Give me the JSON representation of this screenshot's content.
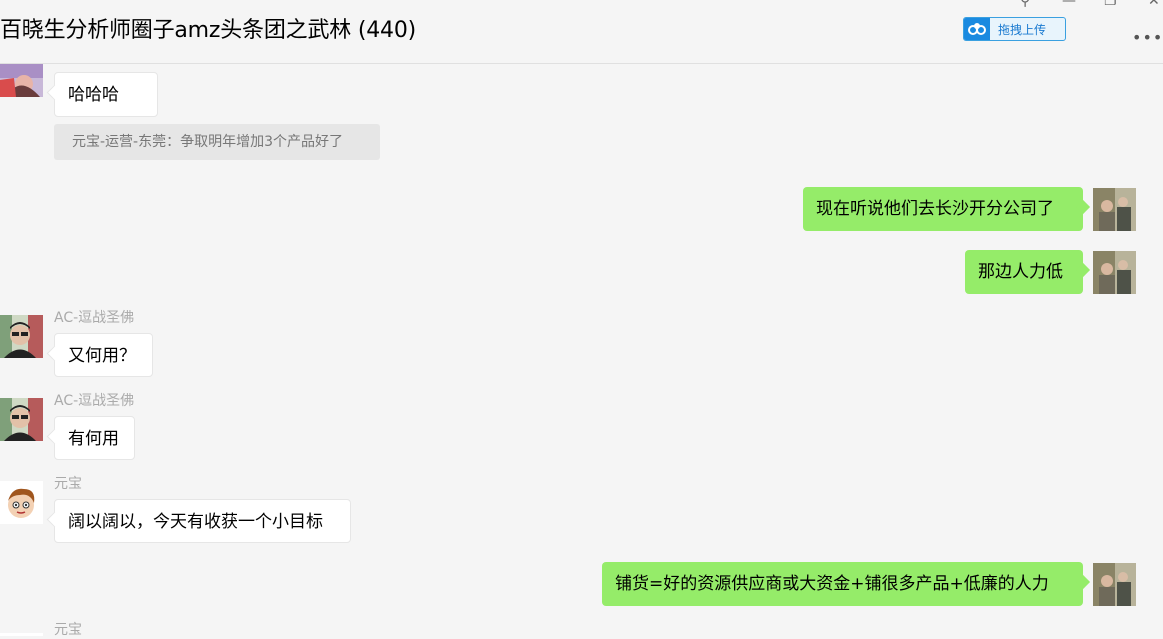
{
  "header": {
    "title": "百晓生分析师圈子amz头条团之武林 (440)",
    "upload_label": "拖拽上传",
    "more_label": "•••"
  },
  "window_controls": {
    "pin": "⚲",
    "minimize": "—",
    "restore": "❐",
    "close": "✕"
  },
  "messages": [
    {
      "side": "left",
      "sender": "",
      "text": "哈哈哈"
    },
    {
      "type": "quote",
      "text": "元宝-运营-东莞：争取明年增加3个产品好了"
    },
    {
      "side": "right",
      "text": "现在听说他们去长沙开分公司了"
    },
    {
      "side": "right",
      "text": "那边人力低"
    },
    {
      "side": "left",
      "sender": "AC-逗战圣佛",
      "text": "又何用？"
    },
    {
      "side": "left",
      "sender": "AC-逗战圣佛",
      "text": "有何用"
    },
    {
      "side": "left",
      "sender": "元宝",
      "text": "阔以阔以，今天有收获一个小目标"
    },
    {
      "side": "right",
      "text": "铺货=好的资源供应商或大资金+铺很多产品+低廉的人力"
    },
    {
      "side": "left",
      "sender": "元宝",
      "text": ""
    }
  ],
  "colors": {
    "bubble_self": "#95ec69",
    "bubble_other": "#ffffff",
    "background": "#f5f5f5"
  }
}
